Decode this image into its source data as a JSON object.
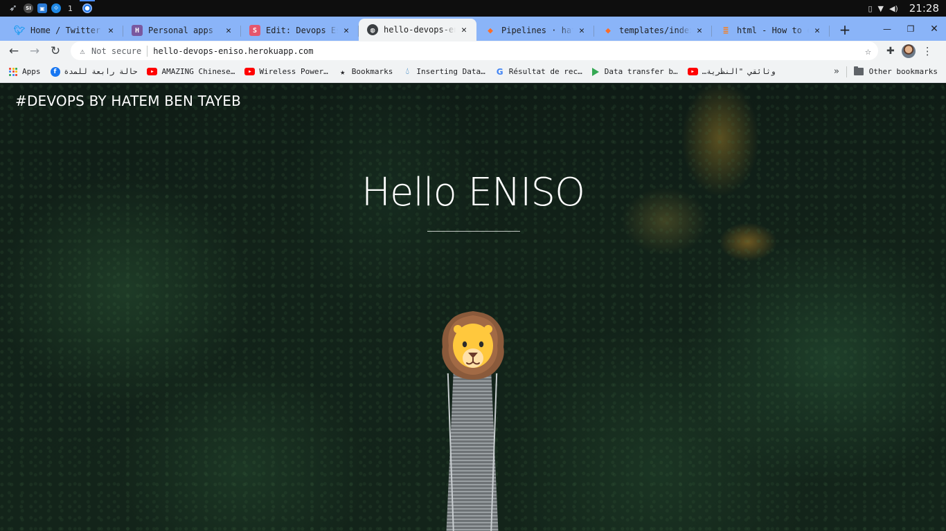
{
  "os": {
    "workspace_number": "1",
    "sl_badge": "SI",
    "clock": "21:28",
    "icons": [
      "rocket-icon",
      "sl-app-icon",
      "image-viewer-icon",
      "vscode-icon",
      "chrome-icon",
      "battery-icon",
      "wifi-icon",
      "volume-icon"
    ]
  },
  "tabs": [
    {
      "title": "Home / Twitter",
      "favicon": "twitter-icon",
      "color": "#1d9bf0",
      "active": false
    },
    {
      "title": "Personal apps | H",
      "favicon": "heroku-icon",
      "color": "#79589f",
      "badge": "H",
      "active": false
    },
    {
      "title": "Edit: Devops Esse",
      "favicon": "s-app-icon",
      "color": "#e5566c",
      "badge": "S",
      "active": false
    },
    {
      "title": "hello-devops-enis",
      "favicon": "globe-icon",
      "color": "#3c4043",
      "active": true
    },
    {
      "title": "Pipelines · hatem",
      "favicon": "gitlab-icon",
      "color": "#fc6d26",
      "active": false
    },
    {
      "title": "templates/index.h",
      "favicon": "gitlab-icon",
      "color": "#fc6d26",
      "active": false
    },
    {
      "title": "html - How to cen",
      "favicon": "stackoverflow-icon",
      "color": "#f48024",
      "active": false
    }
  ],
  "toolbar": {
    "security_label": "Not secure",
    "url": "hello-devops-eniso.herokuapp.com"
  },
  "bookmarks": [
    {
      "label": "Apps",
      "icon": "apps-grid-icon"
    },
    {
      "label": "حالة رابعة للمدة",
      "icon": "facebook-icon"
    },
    {
      "label": "AMAZING Chinese…",
      "icon": "youtube-icon"
    },
    {
      "label": "Wireless Power…",
      "icon": "youtube-icon"
    },
    {
      "label": "Bookmarks",
      "icon": "star-icon"
    },
    {
      "label": "Inserting Data…",
      "icon": "drupal-icon"
    },
    {
      "label": "Résultat de rec…",
      "icon": "google-icon"
    },
    {
      "label": "Data transfer b…",
      "icon": "google-play-icon"
    },
    {
      "label": "وثائقي \"النظرية…",
      "icon": "youtube-icon"
    }
  ],
  "bookmarks_overflow": "»",
  "other_bookmarks": "Other bookmarks",
  "page": {
    "brand": "#DEVOPS BY HATEM BEN TAYEB",
    "hero_title": "Hello ENISO",
    "hero_image": "lion-emoji"
  }
}
